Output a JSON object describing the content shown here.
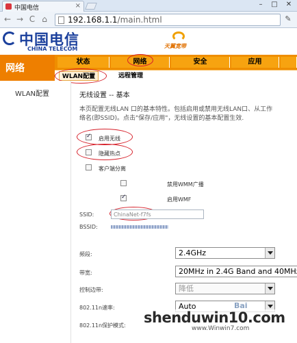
{
  "browser": {
    "tab_title": "中国电信",
    "tab_close": "×",
    "url_host": "192.168.1.1",
    "url_path": "/main.html",
    "back": "←",
    "forward": "→",
    "reload": "C",
    "home": "⌂",
    "wrench": "✎",
    "minimize": "–",
    "maximize": "□",
    "close": "✕"
  },
  "brand": {
    "logo_cn": "中国电信",
    "logo_en": "CHINA TELECOM",
    "tianyi": "天翼宽带"
  },
  "nav": {
    "section": "网络",
    "tabs": [
      "状态",
      "网络",
      "安全",
      "应用"
    ],
    "active_tab": "网络",
    "subtabs": [
      "WLAN配置",
      "远程管理"
    ],
    "active_subtab": "WLAN配置"
  },
  "sidebar": {
    "items": [
      "WLAN配置"
    ]
  },
  "content": {
    "title": "无线设置 -- 基本",
    "desc_line1": "本页配置无线LAN 口的基本特性。包括启用或禁用无线LAN口、从工作",
    "desc_line2": "络名(即SSID)。点击\"保存/应用\"，无线设置的基本配置生效.",
    "checkboxes": {
      "enable_wireless": {
        "label": "启用无线",
        "checked": true
      },
      "hide_ap": {
        "label": "隐藏热点",
        "checked": false
      },
      "client_isolation": {
        "label": "客户端分离",
        "checked": false
      },
      "disable_wmm": {
        "label": "禁用WMM广播",
        "checked": false
      },
      "enable_wmf": {
        "label": "启用WMF",
        "checked": true
      }
    },
    "ssid_label": "SSID:",
    "ssid_value": "ChinaNet-f7fs",
    "bssid_label": "BSSID:",
    "band_label": "频段:",
    "band_value": "2.4GHz",
    "bandwidth_label": "带宽:",
    "bandwidth_value": "20MHz in 2.4G Band and 40MHz",
    "control_sideband_label": "控制边带:",
    "control_sideband_value": "降低",
    "rate_label": "802.11n速率:",
    "rate_value": "Auto",
    "protection_label": "802.11n保护模式:"
  },
  "watermark": {
    "main": "shenduwin10.com",
    "sub": "www.Winwin7.com",
    "corner": "Bai"
  },
  "colors": {
    "nav_orange": "#ef8e00",
    "tab_orange": "#f7a310",
    "brand_blue": "#1a3f9c",
    "annotation_red": "#d6202a"
  }
}
